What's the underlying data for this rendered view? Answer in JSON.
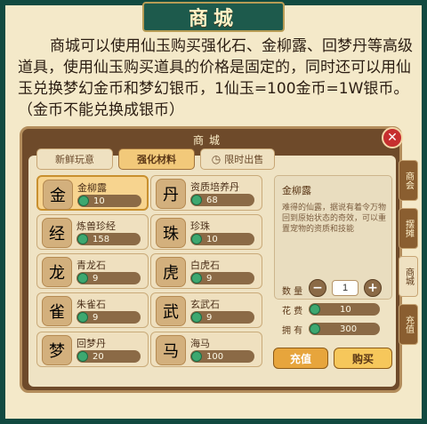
{
  "banner_title": "商城",
  "intro_text": "商城可以使用仙玉购买强化石、金柳露、回梦丹等高级道具，使用仙玉购买道具的价格是固定的，同时还可以用仙玉兑换梦幻金币和梦幻银币，1仙玉=100金币=1W银币。（金币不能兑换成银币）",
  "shop": {
    "title": "商城",
    "close_label": "✕",
    "tabs": [
      {
        "label": "新鲜玩意",
        "active": false
      },
      {
        "label": "强化材料",
        "active": true
      },
      {
        "label": "限时出售",
        "active": false,
        "icon": "clock-icon"
      }
    ],
    "items": [
      {
        "name": "金柳露",
        "price": "10",
        "icon": "金",
        "active": true
      },
      {
        "name": "资质培养丹",
        "price": "68",
        "icon": "丹",
        "active": false
      },
      {
        "name": "炼兽珍经",
        "price": "158",
        "icon": "经",
        "active": false
      },
      {
        "name": "珍珠",
        "price": "10",
        "icon": "珠",
        "active": false
      },
      {
        "name": "青龙石",
        "price": "9",
        "icon": "龙",
        "active": false
      },
      {
        "name": "白虎石",
        "price": "9",
        "icon": "虎",
        "active": false
      },
      {
        "name": "朱雀石",
        "price": "9",
        "icon": "雀",
        "active": false
      },
      {
        "name": "玄武石",
        "price": "9",
        "icon": "武",
        "active": false
      },
      {
        "name": "回梦丹",
        "price": "20",
        "icon": "梦",
        "active": false
      },
      {
        "name": "海马",
        "price": "100",
        "icon": "马",
        "active": false
      }
    ],
    "detail": {
      "name": "金柳露",
      "description": "难得的仙露，据说有着令万物回到原始状态的奇效，可以重置宠物的资质和技能"
    },
    "quantity_label": "数 量",
    "quantity_value": "1",
    "cost_label": "花 费",
    "cost_value": "10",
    "own_label": "拥 有",
    "own_value": "300",
    "recharge_label": "充值",
    "buy_label": "购买",
    "side_tabs": [
      "商会",
      "摆摊",
      "商城",
      "充值"
    ]
  },
  "colors": {
    "accent": "#f6c75b",
    "jade": "#3da870",
    "frame": "#114a40"
  }
}
